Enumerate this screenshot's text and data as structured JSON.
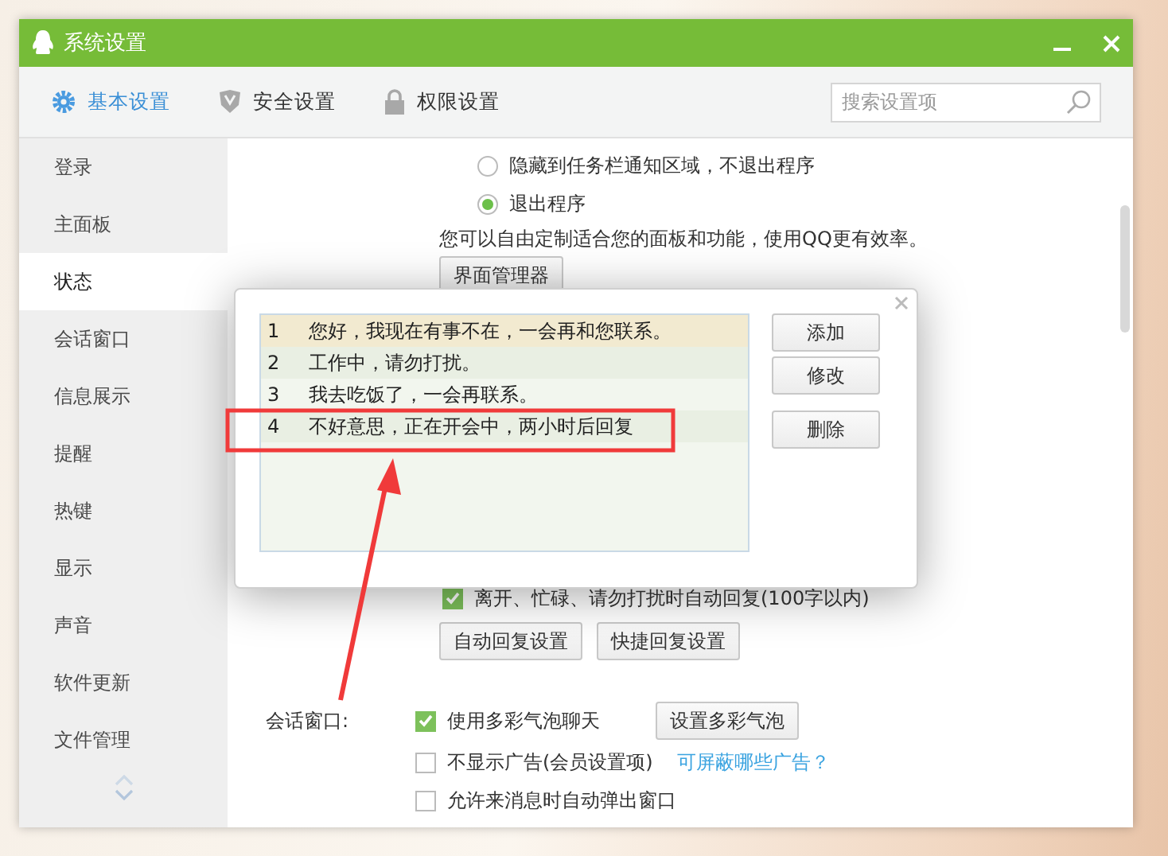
{
  "window": {
    "title": "系统设置"
  },
  "tabs": [
    {
      "label": "基本设置",
      "selected": true,
      "kind": "gear"
    },
    {
      "label": "安全设置",
      "selected": false,
      "kind": "shield"
    },
    {
      "label": "权限设置",
      "selected": false,
      "kind": "lock"
    }
  ],
  "search": {
    "placeholder": "搜索设置项"
  },
  "sidebar": {
    "items": [
      {
        "label": "登录",
        "selected": false
      },
      {
        "label": "主面板",
        "selected": false
      },
      {
        "label": "状态",
        "selected": true
      },
      {
        "label": "会话窗口",
        "selected": false
      },
      {
        "label": "信息展示",
        "selected": false
      },
      {
        "label": "提醒",
        "selected": false
      },
      {
        "label": "热键",
        "selected": false
      },
      {
        "label": "显示",
        "selected": false
      },
      {
        "label": "声音",
        "selected": false
      },
      {
        "label": "软件更新",
        "selected": false
      },
      {
        "label": "文件管理",
        "selected": false
      }
    ]
  },
  "close_options": [
    {
      "label": "隐藏到任务栏通知区域，不退出程序",
      "selected": false
    },
    {
      "label": "退出程序",
      "selected": true
    }
  ],
  "panel_hint": "您可以自由定制适合您的面板和功能，使用QQ更有效率。",
  "panel_button": "界面管理器",
  "auto_reply": {
    "label": "离开、忙碌、请勿打扰时自动回复(100字以内)",
    "checked": true
  },
  "auto_reply_buttons": [
    "自动回复设置",
    "快捷回复设置"
  ],
  "chat_window": {
    "label": "会话窗口:",
    "options": [
      {
        "label": "使用多彩气泡聊天",
        "checked": true,
        "button": "设置多彩气泡"
      },
      {
        "label": "不显示广告(会员设置项)",
        "checked": false,
        "link": "可屏蔽哪些广告？"
      },
      {
        "label": "允许来消息时自动弹出窗口",
        "checked": false
      }
    ]
  },
  "dialog": {
    "rows": [
      {
        "number": "1",
        "text": "您好，我现在有事不在，一会再和您联系。",
        "selected": true
      },
      {
        "number": "2",
        "text": "工作中，请勿打扰。",
        "selected": false
      },
      {
        "number": "3",
        "text": "我去吃饭了，一会再联系。",
        "selected": false
      },
      {
        "number": "4",
        "text": "不好意思，正在开会中，两小时后回复",
        "selected": false
      }
    ],
    "buttons": [
      "添加",
      "修改",
      "删除"
    ]
  }
}
